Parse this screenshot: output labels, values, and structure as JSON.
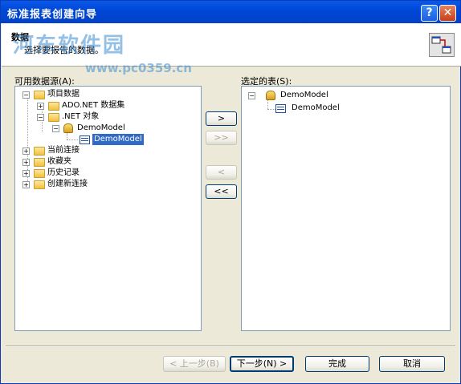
{
  "window": {
    "title": "标准报表创建向导"
  },
  "header": {
    "title": "数据",
    "subtitle": "选择要报告的数据。",
    "watermark": "河东软件园",
    "watermark_url": "www.pc0359.cn"
  },
  "left": {
    "label": "可用数据源(A):",
    "tree": [
      {
        "label": "项目数据"
      },
      {
        "label": "ADO.NET 数据集"
      },
      {
        "label": ".NET 对象"
      },
      {
        "label": "DemoModel"
      },
      {
        "label": "DemoModel"
      },
      {
        "label": "当前连接"
      },
      {
        "label": "收藏夹"
      },
      {
        "label": "历史记录"
      },
      {
        "label": "创建新连接"
      }
    ]
  },
  "right": {
    "label": "选定的表(S):",
    "tree": [
      {
        "label": "DemoModel"
      },
      {
        "label": "DemoModel"
      }
    ]
  },
  "transfer": {
    "add": ">",
    "add_all": ">>",
    "remove": "<",
    "remove_all": "<<"
  },
  "footer": {
    "back": "< 上一步(B)",
    "next": "下一步(N) >",
    "finish": "完成",
    "cancel": "取消"
  }
}
